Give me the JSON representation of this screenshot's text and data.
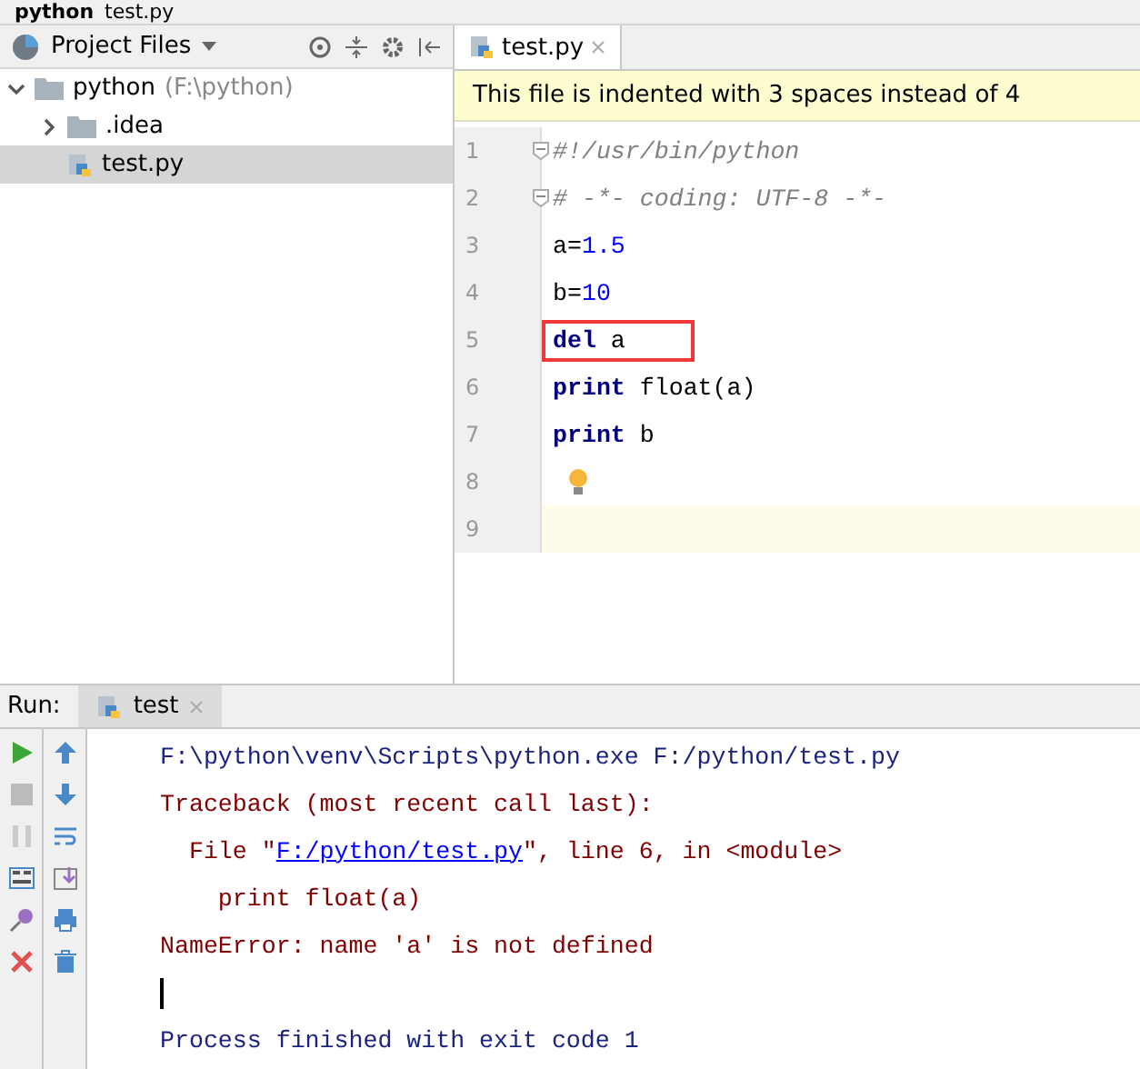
{
  "breadcrumb": [
    "python",
    "test.py"
  ],
  "project": {
    "title": "Project Files",
    "tree": [
      {
        "name": "python",
        "note": "(F:\\python)",
        "kind": "folder",
        "expanded": true,
        "selected": false,
        "children": [
          {
            "name": ".idea",
            "kind": "folder",
            "expanded": false,
            "selected": false
          },
          {
            "name": "test.py",
            "kind": "pyfile",
            "selected": true
          }
        ]
      }
    ]
  },
  "editor": {
    "tabs": [
      {
        "label": "test.py",
        "selected": true
      }
    ],
    "banner": "This file is indented with 3 spaces instead of 4",
    "lines": [
      {
        "number": "1",
        "current": false,
        "bulb": false,
        "fold": true,
        "tokens": [
          {
            "text": "#!/usr/bin/python",
            "kind": "comment"
          }
        ]
      },
      {
        "number": "2",
        "current": false,
        "bulb": false,
        "fold": true,
        "tokens": [
          {
            "text": "# -*- coding: UTF-8 -*-",
            "kind": "comment"
          }
        ]
      },
      {
        "number": "3",
        "current": false,
        "bulb": false,
        "fold": false,
        "tokens": [
          {
            "text": "a=",
            "kind": "plain"
          },
          {
            "text": "1.5",
            "kind": "number"
          }
        ]
      },
      {
        "number": "4",
        "current": false,
        "bulb": false,
        "fold": false,
        "tokens": [
          {
            "text": "b=",
            "kind": "plain"
          },
          {
            "text": "10",
            "kind": "number"
          }
        ]
      },
      {
        "number": "5",
        "marked": true,
        "current": false,
        "bulb": false,
        "fold": false,
        "tokens": [
          {
            "text": "del",
            "kind": "keyword"
          },
          {
            "text": " a",
            "kind": "plain"
          }
        ]
      },
      {
        "number": "6",
        "current": false,
        "bulb": false,
        "fold": false,
        "tokens": [
          {
            "text": "print",
            "kind": "keyword"
          },
          {
            "text": " float(a)",
            "kind": "plain"
          }
        ]
      },
      {
        "number": "7",
        "current": false,
        "bulb": false,
        "fold": false,
        "tokens": [
          {
            "text": "print",
            "kind": "keyword"
          },
          {
            "text": " b",
            "kind": "plain"
          }
        ]
      },
      {
        "number": "8",
        "current": false,
        "bulb": true,
        "fold": false
      },
      {
        "number": "9",
        "current": true,
        "bulb": false,
        "fold": false
      }
    ]
  },
  "run": {
    "label": "Run:",
    "tabs": [
      {
        "label": "test",
        "selected": true
      }
    ],
    "output": [
      {
        "parts": [
          {
            "text": "F:\\python\\venv\\Scripts\\python.exe F:/python/test.py",
            "kind": "info"
          }
        ]
      },
      {
        "parts": [
          {
            "text": "Traceback (most recent call last):",
            "kind": "error"
          }
        ]
      },
      {
        "parts": [
          {
            "text": "  File \"",
            "kind": "error"
          },
          {
            "text": "F:/python/test.py",
            "kind": "link"
          },
          {
            "text": "\", line 6, in <module>",
            "kind": "error"
          }
        ]
      },
      {
        "parts": [
          {
            "text": "    print float(a)",
            "kind": "error"
          }
        ]
      },
      {
        "parts": [
          {
            "text": "NameError: name 'a' is not defined",
            "kind": "error"
          }
        ]
      },
      {
        "cursor": true
      },
      {
        "parts": [
          {
            "text": "Process finished with exit code 1",
            "kind": "info"
          }
        ]
      }
    ]
  }
}
